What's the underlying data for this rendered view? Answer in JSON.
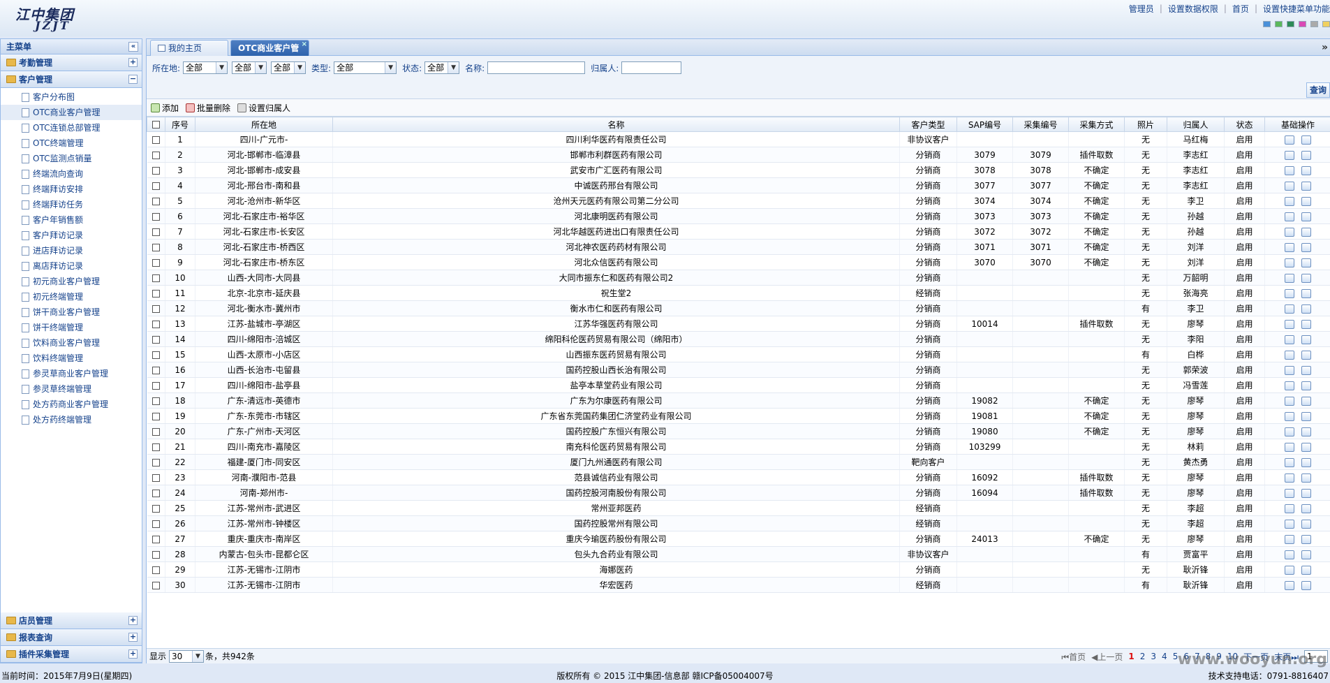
{
  "header": {
    "logo_cn": "江中集团",
    "logo_en": "JZJT",
    "links": [
      "管理员",
      "设置数据权限",
      "首页",
      "设置快捷菜单功能"
    ],
    "skins": [
      "#4a90d9",
      "#5cb85c",
      "#2e8b57",
      "#d94ab5",
      "#aaaaaa",
      "#f0d060"
    ]
  },
  "left": {
    "title": "主菜单",
    "collapse": "«",
    "sections_top": [
      {
        "label": "考勤管理",
        "toggle": "+"
      },
      {
        "label": "客户管理",
        "toggle": "−"
      }
    ],
    "tree": [
      "客户分布图",
      "OTC商业客户管理",
      "OTC连锁总部管理",
      "OTC终端管理",
      "OTC监测点销量",
      "终端流向查询",
      "终端拜访安排",
      "终端拜访任务",
      "客户年销售额",
      "客户拜访记录",
      "进店拜访记录",
      "离店拜访记录",
      "初元商业客户管理",
      "初元终端管理",
      "饼干商业客户管理",
      "饼干终端管理",
      "饮料商业客户管理",
      "饮料终端管理",
      "参灵草商业客户管理",
      "参灵草终端管理",
      "处方药商业客户管理",
      "处方药终端管理"
    ],
    "active_index": 1,
    "sections_bottom": [
      {
        "label": "店员管理",
        "toggle": "+"
      },
      {
        "label": "报表查询",
        "toggle": "+"
      },
      {
        "label": "插件采集管理",
        "toggle": "+"
      }
    ]
  },
  "tabs": [
    {
      "label": "我的主页"
    },
    {
      "label": "OTC商业客户管",
      "close": "×"
    }
  ],
  "tab_scroll": "»",
  "filter": {
    "location_label": "所在地:",
    "location_values": [
      "全部",
      "全部",
      "全部"
    ],
    "type_label": "类型:",
    "type_value": "全部",
    "status_label": "状态:",
    "status_value": "全部",
    "name_label": "名称:",
    "name_value": "",
    "owner_label": "归属人:",
    "owner_value": "",
    "query_button": "查询"
  },
  "toolbar": {
    "add": "添加",
    "batch_delete": "批量删除",
    "set_owner": "设置归属人"
  },
  "grid": {
    "columns": [
      "",
      "序号",
      "所在地",
      "名称",
      "客户类型",
      "SAP编号",
      "采集编号",
      "采集方式",
      "照片",
      "归属人",
      "状态",
      "基础操作"
    ],
    "rows": [
      [
        "1",
        "四川-广元市-",
        "四川利华医药有限责任公司",
        "非协议客户",
        "",
        "",
        "",
        "无",
        "马红梅",
        "启用"
      ],
      [
        "2",
        "河北-邯郸市-临漳县",
        "邯郸市利群医药有限公司",
        "分销商",
        "3079",
        "3079",
        "插件取数",
        "无",
        "李志红",
        "启用"
      ],
      [
        "3",
        "河北-邯郸市-成安县",
        "武安市广汇医药有限公司",
        "分销商",
        "3078",
        "3078",
        "不确定",
        "无",
        "李志红",
        "启用"
      ],
      [
        "4",
        "河北-邢台市-南和县",
        "中诚医药邢台有限公司",
        "分销商",
        "3077",
        "3077",
        "不确定",
        "无",
        "李志红",
        "启用"
      ],
      [
        "5",
        "河北-沧州市-新华区",
        "沧州天元医药有限公司第二分公司",
        "分销商",
        "3074",
        "3074",
        "不确定",
        "无",
        "李卫",
        "启用"
      ],
      [
        "6",
        "河北-石家庄市-裕华区",
        "河北康明医药有限公司",
        "分销商",
        "3073",
        "3073",
        "不确定",
        "无",
        "孙越",
        "启用"
      ],
      [
        "7",
        "河北-石家庄市-长安区",
        "河北华越医药进出口有限责任公司",
        "分销商",
        "3072",
        "3072",
        "不确定",
        "无",
        "孙越",
        "启用"
      ],
      [
        "8",
        "河北-石家庄市-桥西区",
        "河北神农医药药材有限公司",
        "分销商",
        "3071",
        "3071",
        "不确定",
        "无",
        "刘洋",
        "启用"
      ],
      [
        "9",
        "河北-石家庄市-桥东区",
        "河北众信医药有限公司",
        "分销商",
        "3070",
        "3070",
        "不确定",
        "无",
        "刘洋",
        "启用"
      ],
      [
        "10",
        "山西-大同市-大同县",
        "大同市振东仁和医药有限公司2",
        "分销商",
        "",
        "",
        "",
        "无",
        "万韶明",
        "启用"
      ],
      [
        "11",
        "北京-北京市-延庆县",
        "祝生堂2",
        "经销商",
        "",
        "",
        "",
        "无",
        "张海亮",
        "启用"
      ],
      [
        "12",
        "河北-衡水市-冀州市",
        "衡水市仁和医药有限公司",
        "分销商",
        "",
        "",
        "",
        "有",
        "李卫",
        "启用"
      ],
      [
        "13",
        "江苏-盐城市-亭湖区",
        "江苏华强医药有限公司",
        "分销商",
        "10014",
        "",
        "插件取数",
        "无",
        "廖琴",
        "启用"
      ],
      [
        "14",
        "四川-绵阳市-涪城区",
        "绵阳科伦医药贸易有限公司（绵阳市）",
        "分销商",
        "",
        "",
        "",
        "无",
        "李阳",
        "启用"
      ],
      [
        "15",
        "山西-太原市-小店区",
        "山西振东医药贸易有限公司",
        "分销商",
        "",
        "",
        "",
        "有",
        "白桦",
        "启用"
      ],
      [
        "16",
        "山西-长治市-屯留县",
        "国药控股山西长治有限公司",
        "分销商",
        "",
        "",
        "",
        "无",
        "郭荣波",
        "启用"
      ],
      [
        "17",
        "四川-绵阳市-盐亭县",
        "盐亭本草堂药业有限公司",
        "分销商",
        "",
        "",
        "",
        "无",
        "冯雪莲",
        "启用"
      ],
      [
        "18",
        "广东-清远市-英德市",
        "广东为尔康医药有限公司",
        "分销商",
        "19082",
        "",
        "不确定",
        "无",
        "廖琴",
        "启用"
      ],
      [
        "19",
        "广东-东莞市-市辖区",
        "广东省东莞国药集团仁济堂药业有限公司",
        "分销商",
        "19081",
        "",
        "不确定",
        "无",
        "廖琴",
        "启用"
      ],
      [
        "20",
        "广东-广州市-天河区",
        "国药控股广东恒兴有限公司",
        "分销商",
        "19080",
        "",
        "不确定",
        "无",
        "廖琴",
        "启用"
      ],
      [
        "21",
        "四川-南充市-嘉陵区",
        "南充科伦医药贸易有限公司",
        "分销商",
        "103299",
        "",
        "",
        "无",
        "林莉",
        "启用"
      ],
      [
        "22",
        "福建-厦门市-同安区",
        "厦门九州通医药有限公司",
        "靶向客户",
        "",
        "",
        "",
        "无",
        "黄杰勇",
        "启用"
      ],
      [
        "23",
        "河南-濮阳市-范县",
        "范县诚信药业有限公司",
        "分销商",
        "16092",
        "",
        "插件取数",
        "无",
        "廖琴",
        "启用"
      ],
      [
        "24",
        "河南-郑州市-",
        "国药控股河南股份有限公司",
        "分销商",
        "16094",
        "",
        "插件取数",
        "无",
        "廖琴",
        "启用"
      ],
      [
        "25",
        "江苏-常州市-武进区",
        "常州亚邦医药",
        "经销商",
        "",
        "",
        "",
        "无",
        "李超",
        "启用"
      ],
      [
        "26",
        "江苏-常州市-钟楼区",
        "国药控股常州有限公司",
        "经销商",
        "",
        "",
        "",
        "无",
        "李超",
        "启用"
      ],
      [
        "27",
        "重庆-重庆市-南岸区",
        "重庆今瑜医药股份有限公司",
        "分销商",
        "24013",
        "",
        "不确定",
        "无",
        "廖琴",
        "启用"
      ],
      [
        "28",
        "内蒙古-包头市-昆都仑区",
        "包头九合药业有限公司",
        "非协议客户",
        "",
        "",
        "",
        "有",
        "贾富平",
        "启用"
      ],
      [
        "29",
        "江苏-无锡市-江阴市",
        "海娜医药",
        "分销商",
        "",
        "",
        "",
        "无",
        "耿沂锋",
        "启用"
      ],
      [
        "30",
        "江苏-无锡市-江阴市",
        "华宏医药",
        "经销商",
        "",
        "",
        "",
        "有",
        "耿沂锋",
        "启用"
      ]
    ]
  },
  "pager": {
    "show_label": "显示",
    "page_size": "30",
    "total_text": "条，共942条",
    "first": "首页",
    "prev": "上一页",
    "pages": [
      "1",
      "2",
      "3",
      "4",
      "5",
      "6",
      "7",
      "8",
      "9",
      "10"
    ],
    "current": "1",
    "next": "下一页",
    "last": "末页",
    "goto_value": "1"
  },
  "footer": {
    "time": "当前时间：2015年7月9日(星期四)",
    "copyright": "版权所有 © 2015 江中集团-信息部 赣ICP备05004007号",
    "support": "技术支持电话：0791-8816407"
  },
  "watermark": "www.wooyun.org"
}
